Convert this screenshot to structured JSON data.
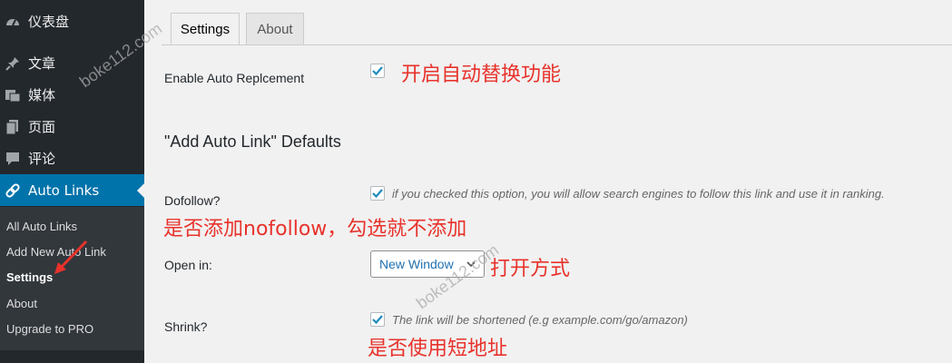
{
  "sidebar": {
    "menu": [
      {
        "label": "仪表盘",
        "icon": "dashboard-icon"
      },
      {
        "label": "文章",
        "icon": "pin-icon"
      },
      {
        "label": "媒体",
        "icon": "media-icon"
      },
      {
        "label": "页面",
        "icon": "pages-icon"
      },
      {
        "label": "评论",
        "icon": "comment-icon"
      },
      {
        "label": "Auto Links",
        "icon": "link-icon",
        "active": true
      }
    ],
    "submenu": [
      {
        "label": "All Auto Links"
      },
      {
        "label": "Add New Auto Link"
      },
      {
        "label": "Settings",
        "current": true
      },
      {
        "label": "About"
      },
      {
        "label": "Upgrade to PRO"
      }
    ]
  },
  "tabs": [
    {
      "label": "Settings",
      "active": true
    },
    {
      "label": "About"
    }
  ],
  "settings": {
    "enable_label": "Enable Auto Replcement",
    "enable_checked": true,
    "section_title": "\"Add Auto Link\" Defaults",
    "dofollow_label": "Dofollow?",
    "dofollow_desc": "if you checked this option, you will allow search engines to follow this link and use it in ranking.",
    "dofollow_checked": true,
    "open_in_label": "Open in:",
    "open_in_value": "New Window",
    "shrink_label": "Shrink?",
    "shrink_desc": "The link will be shortened (e.g example.com/go/amazon)",
    "shrink_checked": true
  },
  "annotations": {
    "enable": "开启自动替换功能",
    "dofollow": "是否添加nofollow，勾选就不添加",
    "open_in": "打开方式",
    "shrink": "是否使用短地址"
  },
  "watermark": "boke112.com",
  "colors": {
    "sidebar_bg": "#23282d",
    "submenu_bg": "#32373c",
    "active_bg": "#0073aa",
    "annotation": "#e8322b",
    "checkmark": "#1e8cbe"
  }
}
